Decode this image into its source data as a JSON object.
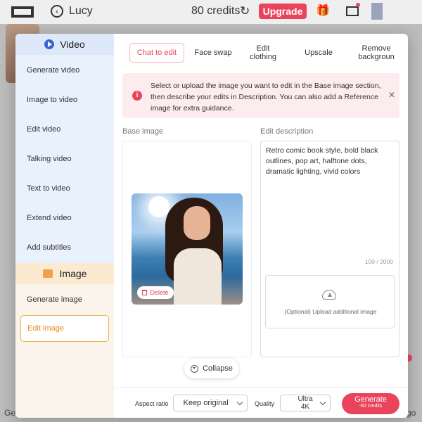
{
  "header": {
    "user_name": "Lucy",
    "credits": "80 credits",
    "upgrade_label": "Upgrade"
  },
  "background": {
    "bottom_left_text": "Ge",
    "bottom_right_text": "go"
  },
  "sidebar": {
    "video_section": {
      "title": "Video",
      "items": [
        "Generate video",
        "Image to video",
        "Edit video",
        "Talking video",
        "Text to video",
        "Extend video",
        "Add subtitles"
      ]
    },
    "image_section": {
      "title": "Image",
      "items": [
        "Generate image",
        "Edit image"
      ],
      "active_item": "Edit image"
    }
  },
  "tabs": [
    {
      "label": "Chat to edit",
      "active": true
    },
    {
      "label": "Face swap",
      "active": false
    },
    {
      "label": "Edit clothing",
      "active": false
    },
    {
      "label": "Upscale",
      "active": false
    },
    {
      "label": "Remove backgroun",
      "active": false
    }
  ],
  "alert": {
    "message": "Select or upload the image you want to edit in the Base image section, then describe your edits in Description. You can also add a Reference image for extra guidance."
  },
  "base_image": {
    "label": "Base image",
    "delete_label": "Delete"
  },
  "edit_description": {
    "label": "Edit description",
    "value": "Retro comic book style, bold black outlines, pop art, halftone dots, dramatic lighting, vivid colors",
    "counter": "100 / 2000",
    "upload_label": "(Optional) Upload additional image"
  },
  "collapse_label": "Collapse",
  "footer": {
    "aspect_ratio_label": "Aspect ratio",
    "aspect_ratio_value": "Keep original",
    "quality_label": "Quality",
    "quality_value": "Ultra 4K",
    "generate_label": "Generate",
    "generate_cost": "-50 credits"
  },
  "colors": {
    "accent": "#e9445c",
    "sidebar_video_bg": "#e9f1fc",
    "sidebar_image_bg": "#fbe9d0",
    "active_orange": "#e88a1a"
  }
}
